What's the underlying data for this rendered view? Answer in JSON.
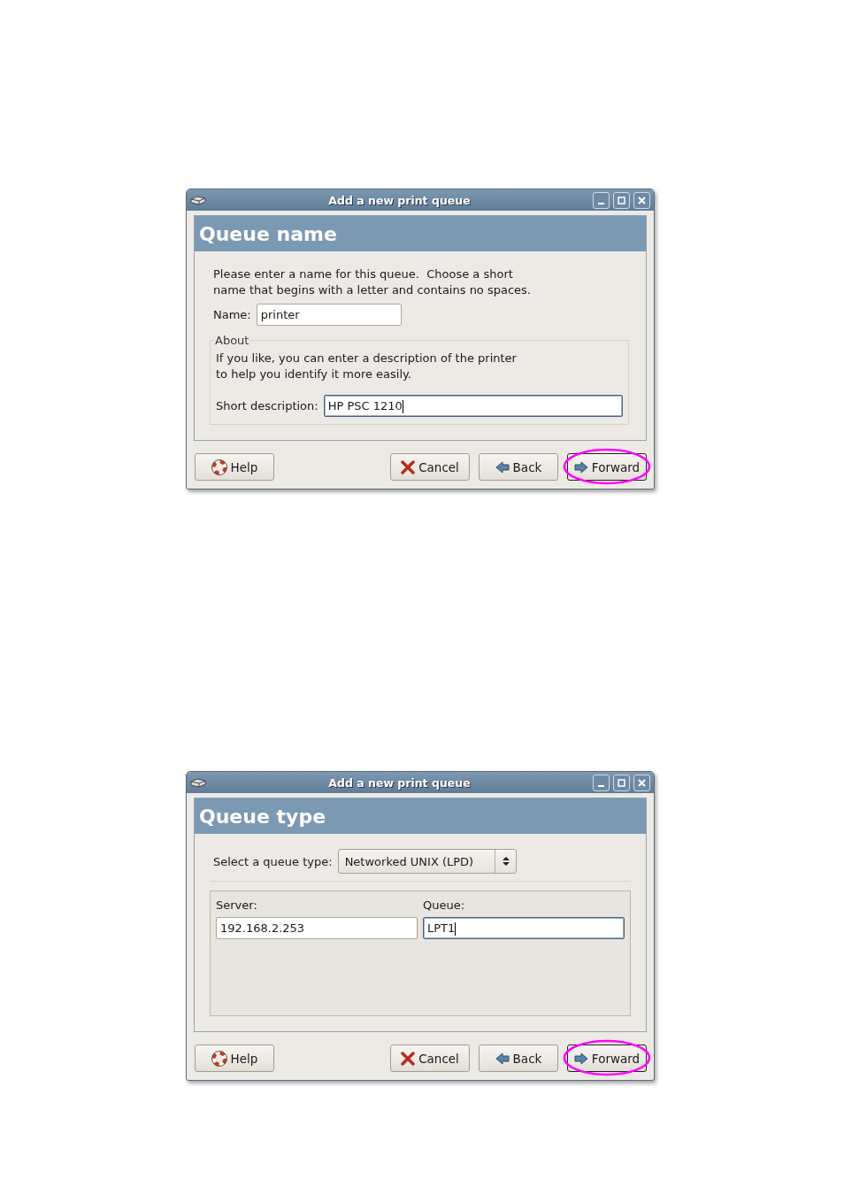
{
  "dialogs": [
    {
      "kind": "name",
      "title": "Add a new print queue",
      "heading": "Queue name",
      "intro": "Please enter a name for this queue.  Choose a short\nname that begins with a letter and contains no spaces.",
      "name_field": {
        "label": "Name:",
        "value": "printer"
      },
      "about": {
        "legend": "About",
        "text": "If you like, you can enter a description of the printer\nto help you identify it more easily.",
        "field": {
          "label": "Short description:",
          "value": "HP PSC 1210"
        }
      },
      "buttons": [
        {
          "kind": "help",
          "label": "Help",
          "highlighted": false
        },
        {
          "kind": "cancel",
          "label": "Cancel",
          "highlighted": false
        },
        {
          "kind": "back",
          "label": "Back",
          "highlighted": false
        },
        {
          "kind": "forward",
          "label": "Forward",
          "highlighted": true
        }
      ]
    },
    {
      "kind": "type",
      "title": "Add a new print queue",
      "heading": "Queue type",
      "select": {
        "label": "Select a queue type:",
        "value": "Networked UNIX (LPD)"
      },
      "fields": [
        {
          "label": "Server:",
          "value": "192.168.2.253"
        },
        {
          "label": "Queue:",
          "value": "LPT1"
        }
      ],
      "buttons": [
        {
          "kind": "help",
          "label": "Help",
          "highlighted": false
        },
        {
          "kind": "cancel",
          "label": "Cancel",
          "highlighted": false
        },
        {
          "kind": "back",
          "label": "Back",
          "highlighted": false
        },
        {
          "kind": "forward",
          "label": "Forward",
          "highlighted": true
        }
      ]
    }
  ]
}
